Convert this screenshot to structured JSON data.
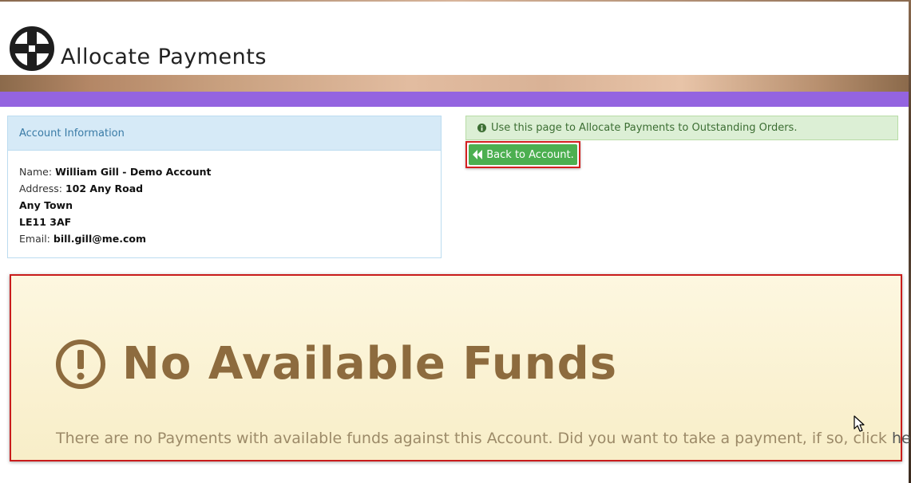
{
  "page": {
    "title": "Allocate Payments"
  },
  "account_panel": {
    "heading": "Account Information",
    "name_label": "Name:",
    "name_value": "William Gill - Demo Account",
    "address_label": "Address:",
    "address_line1": "102 Any Road",
    "address_line2": "Any Town",
    "address_line3": "LE11 3AF",
    "email_label": "Email:",
    "email_value": "bill.gill@me.com"
  },
  "info_alert": {
    "text": "Use this page to Allocate Payments to Outstanding Orders."
  },
  "back_button": {
    "label": "Back to Account."
  },
  "no_funds": {
    "title": "No Available Funds",
    "message": "There are no Payments with available funds against this Account. Did you want to take a payment, if so, click ",
    "link_text": "here"
  },
  "colors": {
    "nav_bar": "#9464e0",
    "panel_heading_bg": "#d6eaf7",
    "success_button": "#4caf50",
    "highlight_border": "#c91c1c",
    "warning_text": "#8d6b3e"
  },
  "icons": [
    "crosshair-logo-icon",
    "info-circle-icon",
    "double-chevron-left-icon",
    "exclamation-circle-icon",
    "mouse-cursor-icon"
  ]
}
